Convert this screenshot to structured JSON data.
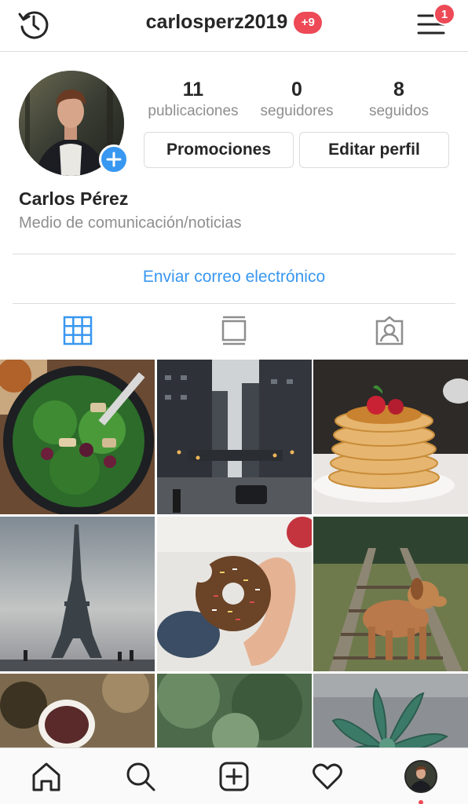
{
  "header": {
    "username": "carlosperz2019",
    "notification_pill": "+9",
    "menu_badge": "1",
    "icons": {
      "left": "history-icon",
      "right": "hamburger-menu-icon"
    }
  },
  "profile": {
    "avatar_icon": "profile-photo",
    "add_icon": "plus-icon",
    "stats": [
      {
        "value": "11",
        "label": "publicaciones"
      },
      {
        "value": "0",
        "label": "seguidores"
      },
      {
        "value": "8",
        "label": "seguidos"
      }
    ],
    "buttons": {
      "promotions": "Promociones",
      "edit": "Editar perfil"
    },
    "full_name": "Carlos Pérez",
    "category": "Medio de comunicación/noticias",
    "email_link": "Enviar correo electrónico"
  },
  "tabs": [
    {
      "name": "grid-icon",
      "active": true
    },
    {
      "name": "feed-icon",
      "active": false
    },
    {
      "name": "tagged-icon",
      "active": false
    }
  ],
  "grid": [
    {
      "name": "salad-photo"
    },
    {
      "name": "city-street-photo"
    },
    {
      "name": "pancakes-photo"
    },
    {
      "name": "eiffel-tower-photo"
    },
    {
      "name": "donut-photo"
    },
    {
      "name": "dog-on-tracks-photo"
    },
    {
      "name": "coffee-cup-photo"
    },
    {
      "name": "foliage-photo"
    },
    {
      "name": "succulent-photo"
    }
  ],
  "bottom_nav": [
    {
      "name": "home-icon"
    },
    {
      "name": "search-icon"
    },
    {
      "name": "new-post-icon"
    },
    {
      "name": "activity-heart-icon"
    },
    {
      "name": "profile-avatar-icon"
    }
  ],
  "colors": {
    "accent_blue": "#3897f0",
    "badge_red": "#ed4956",
    "text_primary": "#262626",
    "text_secondary": "#8e8e8e",
    "border": "#dbdbdb"
  }
}
